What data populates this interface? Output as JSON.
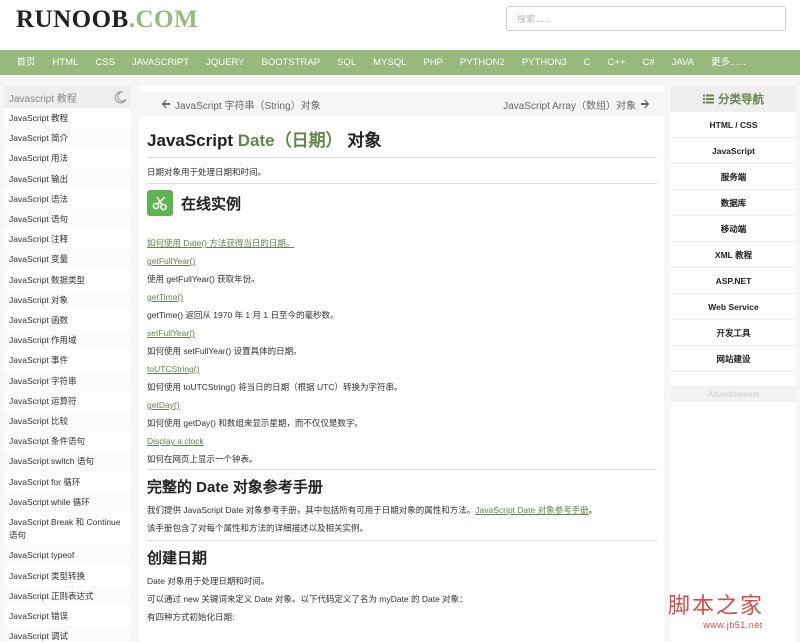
{
  "header": {
    "logo_part1": "RUNOOB",
    "logo_part2": ".COM",
    "search_placeholder": "搜索......"
  },
  "nav": [
    "首页",
    "HTML",
    "CSS",
    "JAVASCRIPT",
    "JQUERY",
    "BOOTSTRAP",
    "SQL",
    "MYSQL",
    "PHP",
    "PYTHON2",
    "PYTHON3",
    "C",
    "C++",
    "C#",
    "JAVA",
    "更多......"
  ],
  "left_sidebar": {
    "title": "Javascript 教程",
    "items": [
      "JavaScript 教程",
      "JavaScript 简介",
      "JavaScript 用法",
      "JavaScript 输出",
      "JavaScript 语法",
      "JavaScript 语句",
      "JavaScript 注释",
      "JavaScript 变量",
      "JavaScript 数据类型",
      "JavaScript 对象",
      "JavaScript 函数",
      "JavaScript 作用域",
      "JavaScript 事件",
      "JavaScript 字符串",
      "JavaScript 运算符",
      "JavaScript 比较",
      "JavaScript 条件语句",
      "JavaScript switch 语句",
      "JavaScript for 循环",
      "JavaScript while 循环",
      "JavaScript Break 和 Continue 语句",
      "JavaScript typeof",
      "JavaScript 类型转换",
      "JavaScript 正则表达式",
      "JavaScript 错误",
      "JavaScript 调试"
    ]
  },
  "pager": {
    "prev": "JavaScript 字符串（String）对象",
    "next": "JavaScript Array（数组）对象"
  },
  "main": {
    "title_pre": "JavaScript ",
    "title_green": "Date（日期）",
    "title_post": " 对象",
    "intro": "日期对象用于处理日期和时间。",
    "examples_heading": "在线实例",
    "examples": [
      {
        "link": "如何使用 Date() 方法获得当日的日期。",
        "desc": ""
      },
      {
        "link": "getFullYear()",
        "desc": "使用 getFullYear() 获取年份。"
      },
      {
        "link": "getTime()",
        "desc": "getTime() 返回从 1970 年 1 月 1 日至今的毫秒数。"
      },
      {
        "link": "setFullYear()",
        "desc": "如何使用 setFullYear() 设置具体的日期。"
      },
      {
        "link": "toUTCString()",
        "desc": "如何使用 toUTCString() 将当日的日期（根据 UTC）转换为字符串。"
      },
      {
        "link": "getDay()",
        "desc": "如何使用 getDay() 和数组来显示星期，而不仅仅是数字。"
      },
      {
        "link": "Display a clock",
        "desc": "如何在网页上显示一个钟表。"
      }
    ],
    "ref_heading": "完整的 Date 对象参考手册",
    "ref_text": "我们提供 JavaScript Date 对象参考手册，其中包括所有可用于日期对象的属性和方法。",
    "ref_link": "JavaScript Date 对象参考手册",
    "ref_text_end": "。",
    "ref_text2": "该手册包含了对每个属性和方法的详细描述以及相关实例。",
    "create_heading": "创建日期",
    "create_p1": "Date 对象用于处理日期和时间。",
    "create_p2": "可以通过 new 关键词来定义 Date 对象。以下代码定义了名为 myDate 的 Date 对象：",
    "create_p3": "有四种方式初始化日期:"
  },
  "right_sidebar": {
    "title": "分类导航",
    "items": [
      "HTML / CSS",
      "JavaScript",
      "服务端",
      "数据库",
      "移动端",
      "XML 教程",
      "ASP.NET",
      "Web Service",
      "开发工具",
      "网站建设"
    ],
    "ad_label": "Advertisement"
  },
  "watermark": {
    "line1": "脚本之家",
    "line2": "www.jb51.net"
  },
  "colors": {
    "brand_green": "#96b97d",
    "link_green": "#64854c",
    "icon_green": "#5eb44f"
  }
}
